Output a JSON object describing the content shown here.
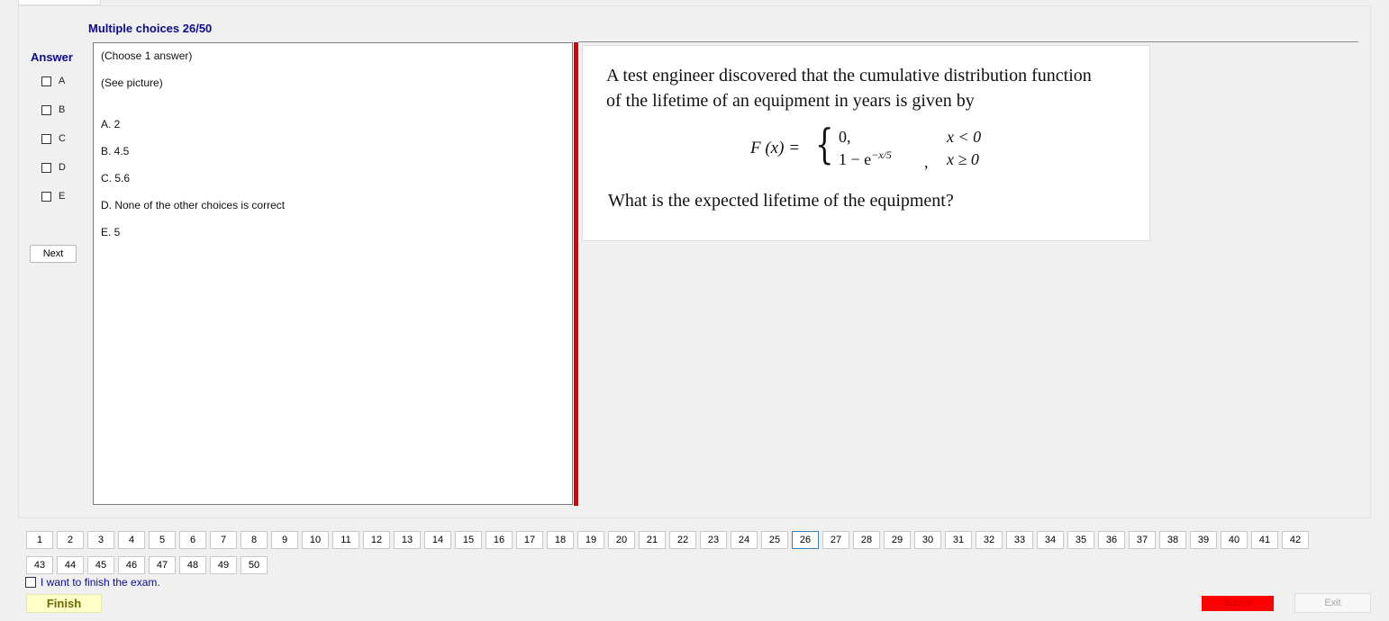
{
  "header": {
    "title": "Multiple choices 26/50"
  },
  "answer_panel": {
    "title": "Answer",
    "options": [
      "A",
      "B",
      "C",
      "D",
      "E"
    ],
    "next_label": "Next"
  },
  "choices": {
    "instruction": "(Choose 1 answer)",
    "note": "(See picture)",
    "items": [
      "A. 2",
      "B. 4.5",
      "C. 5.6",
      "D. None of the other choices is correct",
      "E. 5"
    ]
  },
  "question": {
    "line1": "A test engineer discovered that the cumulative distribution function",
    "line2": "of the lifetime of an equipment in years is given by",
    "formula_lhs": "F (x) =",
    "case1_value": "0,",
    "case1_condition": "x < 0",
    "case2_value": "1 − e",
    "case2_exponent": "−x/5",
    "case2_comma": ",",
    "case2_condition": "x ≥ 0",
    "line3": "What is the expected lifetime of the equipment?"
  },
  "pagination": {
    "pages": [
      "1",
      "2",
      "3",
      "4",
      "5",
      "6",
      "7",
      "8",
      "9",
      "10",
      "11",
      "12",
      "13",
      "14",
      "15",
      "16",
      "17",
      "18",
      "19",
      "20",
      "21",
      "22",
      "23",
      "24",
      "25",
      "26",
      "27",
      "28",
      "29",
      "30",
      "31",
      "32",
      "33",
      "34",
      "35",
      "36",
      "37",
      "38",
      "39",
      "40",
      "41",
      "42",
      "43",
      "44",
      "45",
      "46",
      "47",
      "48",
      "49",
      "50"
    ],
    "current": "26"
  },
  "footer": {
    "finish_check_label": "I want to finish the exam.",
    "finish_label": "Finish",
    "submit_label": "Submit",
    "exit_label": "Exit"
  },
  "colors": {
    "accent_blue": "#0b0b8c",
    "divider_red": "#d80000",
    "submit_red": "#ff0000",
    "finish_yellow": "#ffffc8"
  }
}
